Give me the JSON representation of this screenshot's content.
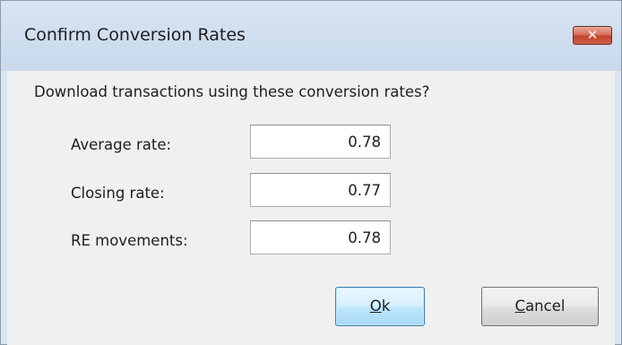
{
  "window": {
    "title": "Confirm Conversion Rates",
    "close_glyph": "✕"
  },
  "prompt": "Download transactions using these conversion rates?",
  "rates": [
    {
      "label": "Average rate:",
      "value": "0.78"
    },
    {
      "label": "Closing rate:",
      "value": "0.77"
    },
    {
      "label": "RE movements:",
      "value": "0.78"
    }
  ],
  "buttons": {
    "ok": {
      "mnemonic": "O",
      "rest": "k"
    },
    "cancel": {
      "mnemonic": "C",
      "rest": "ancel"
    }
  },
  "colors": {
    "close_button": "#c0432c",
    "ok_border": "#3c7fb1",
    "frame": "#dbe6f3"
  }
}
